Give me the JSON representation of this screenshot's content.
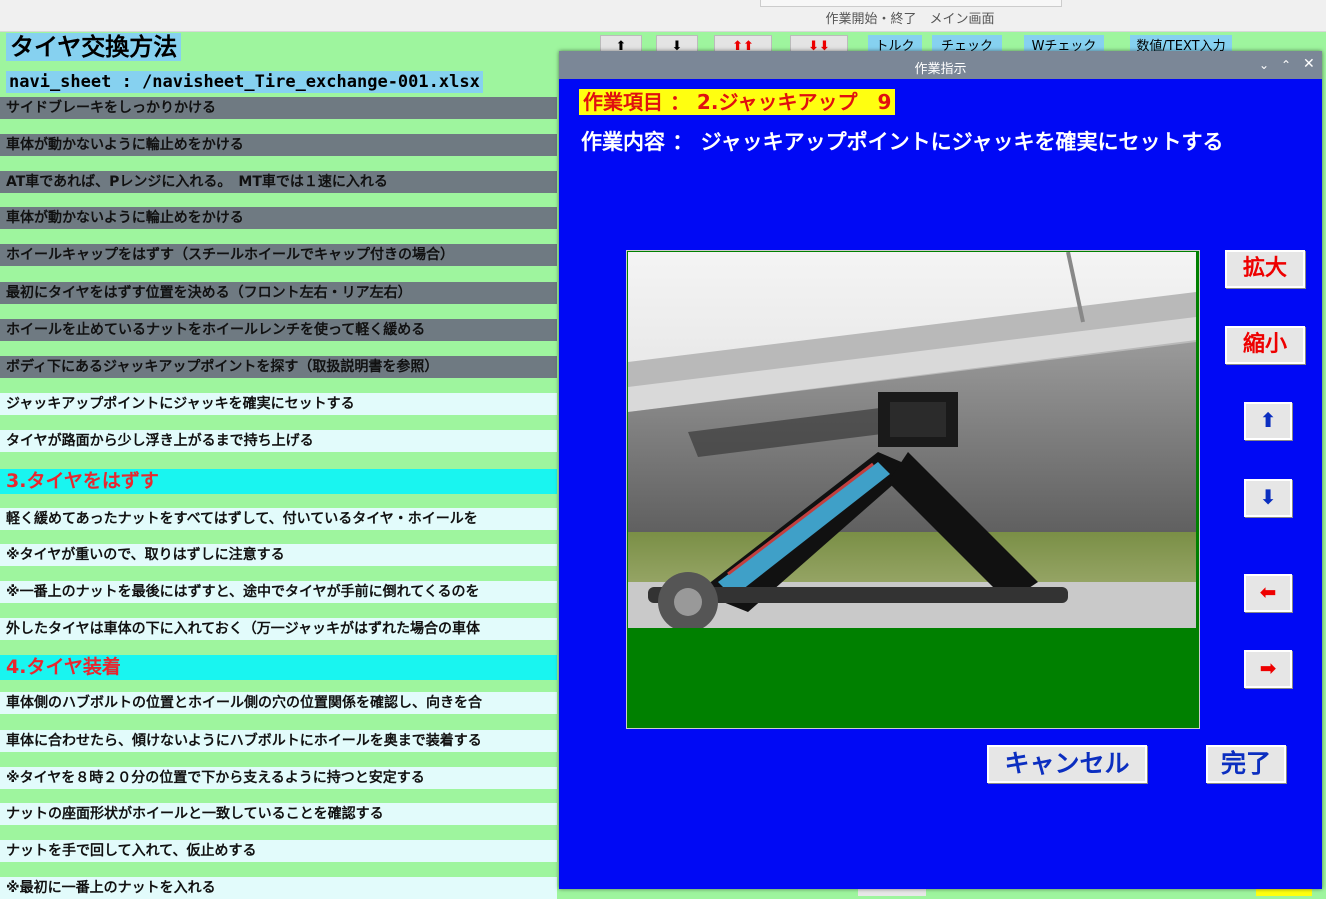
{
  "topbar": {
    "title": "作業開始・終了　メイン画面"
  },
  "sheet": {
    "title": "タイヤ交換方法",
    "file": "navi_sheet : /navisheet_Tire_exchange-001.xlsx",
    "rows": [
      {
        "text": "サイドブレーキをしっかりかける",
        "state": "done"
      },
      {
        "text": "車体が動かないように輪止めをかける",
        "state": "done"
      },
      {
        "text": "AT車であれば、Pレンジに入れる。　MT車では１速に入れる",
        "state": "done"
      },
      {
        "text": "車体が動かないように輪止めをかける",
        "state": "done"
      },
      {
        "text": "ホイールキャップをはずす（スチールホイールでキャップ付きの場合）",
        "state": "done"
      },
      {
        "text": "最初にタイヤをはずす位置を決める（フロント左右・リア左右）",
        "state": "done"
      },
      {
        "text": "ホイールを止めているナットをホイールレンチを使って軽く緩める",
        "state": "done"
      },
      {
        "text": "ボディ下にあるジャッキアップポイントを探す（取扱説明書を参照）",
        "state": "done"
      },
      {
        "text": "ジャッキアップポイントにジャッキを確実にセットする",
        "state": "todo"
      },
      {
        "text": "タイヤが路面から少し浮き上がるまで持ち上げる",
        "state": "todo"
      },
      {
        "text": "3.タイヤをはずす",
        "state": "head"
      },
      {
        "text": "軽く緩めてあったナットをすべてはずして、付いているタイヤ・ホイールを",
        "state": "todo"
      },
      {
        "text": "※タイヤが重いので、取りはずしに注意する",
        "state": "todo"
      },
      {
        "text": "※一番上のナットを最後にはずすと、途中でタイヤが手前に倒れてくるのを",
        "state": "todo"
      },
      {
        "text": "外したタイヤは車体の下に入れておく（万一ジャッキがはずれた場合の車体",
        "state": "todo"
      },
      {
        "text": "4.タイヤ装着",
        "state": "head"
      },
      {
        "text": "車体側のハブボルトの位置とホイール側の穴の位置関係を確認し、向きを合",
        "state": "todo"
      },
      {
        "text": "車体に合わせたら、傾けないようにハブボルトにホイールを奥まで装着する",
        "state": "todo"
      },
      {
        "text": "※タイヤを８時２０分の位置で下から支えるように持つと安定する",
        "state": "todo"
      },
      {
        "text": "ナットの座面形状がホイールと一致していることを確認する",
        "state": "todo"
      },
      {
        "text": "ナットを手で回して入れて、仮止めする",
        "state": "todo"
      },
      {
        "text": "※最初に一番上のナットを入れる",
        "state": "todo"
      }
    ]
  },
  "toolbar": {
    "up": "⬆",
    "down": "⬇",
    "up_double": "⬆⬆",
    "down_double": "⬇⬇",
    "torque": "トルク",
    "check": "チェック",
    "w_check": "Wチェック",
    "numeric_text": "数値/TEXT入力"
  },
  "dialog": {
    "title": "作業指示",
    "item": "作業項目 ： 2.ジャッキアップ　9",
    "content": "作業内容 ： ジャッキアップポイントにジャッキを確実にセットする",
    "zoom_in": "拡大",
    "zoom_out": "縮小",
    "cancel": "キャンセル",
    "complete": "完了",
    "photo_icon": "car-jack-photo"
  },
  "colors": {
    "sheet_bg": "#9ef59e",
    "dialog_bg": "#0009f5",
    "highlight_yellow": "#ffff10",
    "header_cyan": "#19f5f0",
    "done_row": "#6f7a82"
  }
}
